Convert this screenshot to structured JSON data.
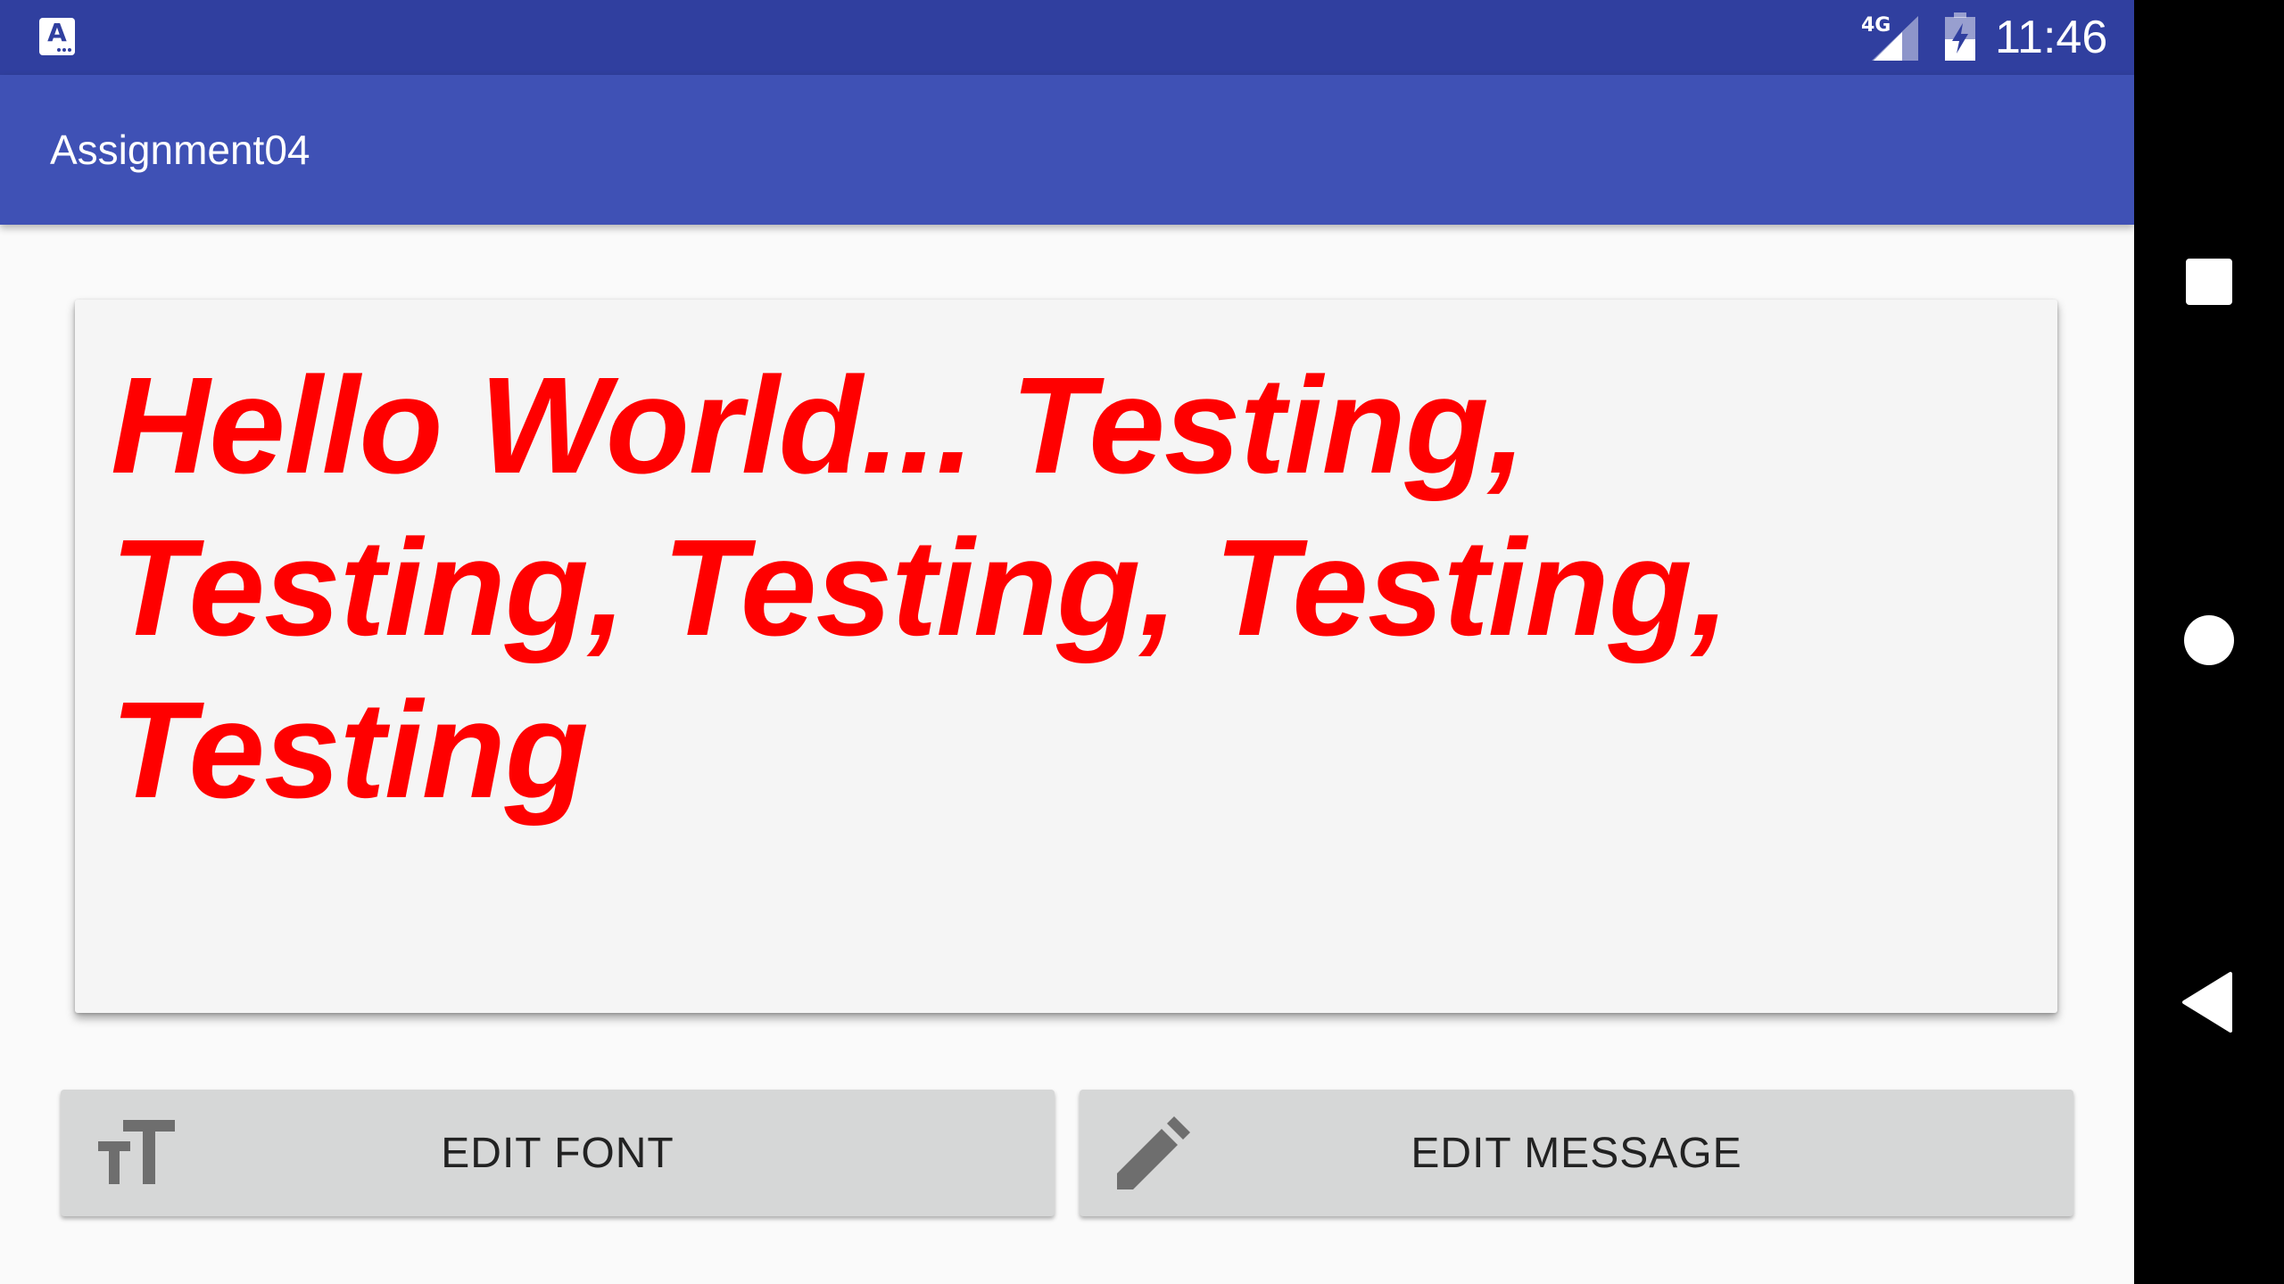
{
  "status_bar": {
    "network": "4G",
    "time": "11:46",
    "app_icon_letter": "A"
  },
  "app_bar": {
    "title": "Assignment04"
  },
  "message": {
    "text": "Hello World... Testing, Testing, Testing, Testing, Testing",
    "color": "#ff0000"
  },
  "buttons": {
    "edit_font": "EDIT FONT",
    "edit_message": "EDIT MESSAGE"
  },
  "colors": {
    "status_bar": "#303f9f",
    "app_bar": "#3f51b5",
    "background": "#fafafa",
    "card": "#f5f5f5",
    "button": "#d6d7d7"
  },
  "icons": {
    "font_size": "format-size-icon",
    "edit": "pencil-icon",
    "recents": "square-icon",
    "home": "circle-icon",
    "back": "triangle-back-icon"
  }
}
